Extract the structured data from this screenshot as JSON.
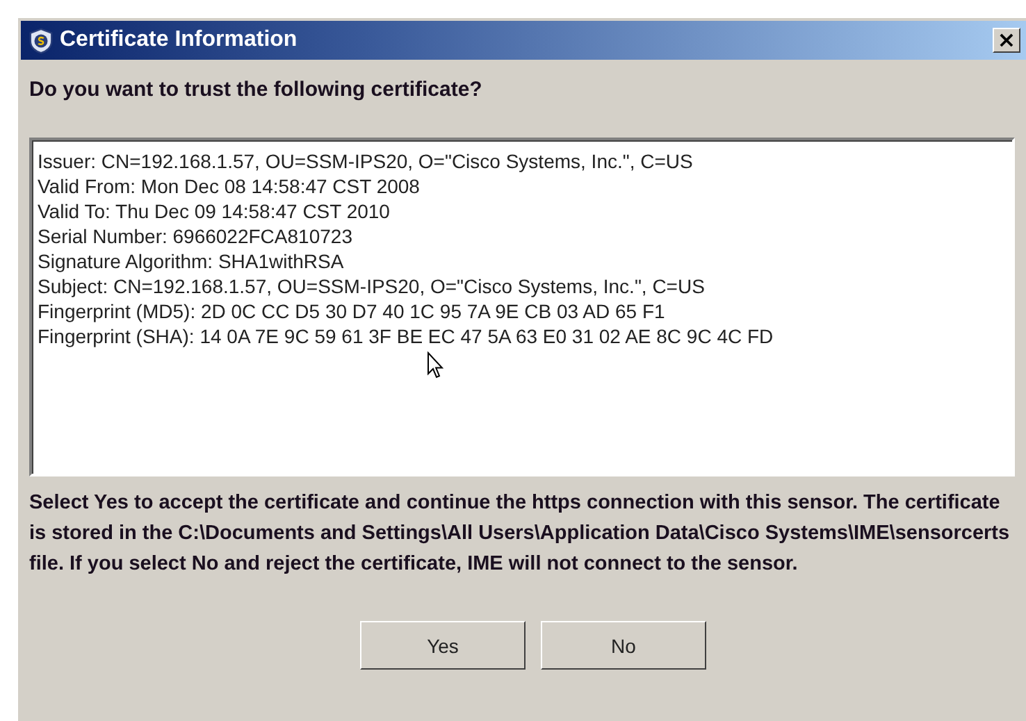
{
  "window": {
    "title": "Certificate Information",
    "close": "×"
  },
  "question": "Do you want to trust the following certificate?",
  "details": [
    "Issuer: CN=192.168.1.57, OU=SSM-IPS20, O=\"Cisco Systems, Inc.\", C=US",
    "Valid From: Mon Dec 08 14:58:47 CST 2008",
    "Valid To: Thu Dec 09 14:58:47 CST 2010",
    "Serial Number: 6966022FCA810723",
    "Signature Algorithm: SHA1withRSA",
    "Subject: CN=192.168.1.57, OU=SSM-IPS20, O=\"Cisco Systems, Inc.\", C=US",
    "Fingerprint (MD5): 2D 0C CC D5 30 D7 40 1C 95 7A 9E CB 03 AD 65 F1",
    "Fingerprint (SHA): 14 0A 7E 9C 59 61 3F BE EC 47 5A 63 E0 31 02 AE 8C 9C 4C FD"
  ],
  "message": "Select Yes to accept the certificate and continue the https connection with this sensor. The certificate is stored in the C:\\Documents and Settings\\All Users\\Application Data\\Cisco Systems\\IME\\sensorcerts file. If you select No and reject the certificate, IME will not connect to the sensor.",
  "buttons": [
    "Yes",
    "No"
  ]
}
